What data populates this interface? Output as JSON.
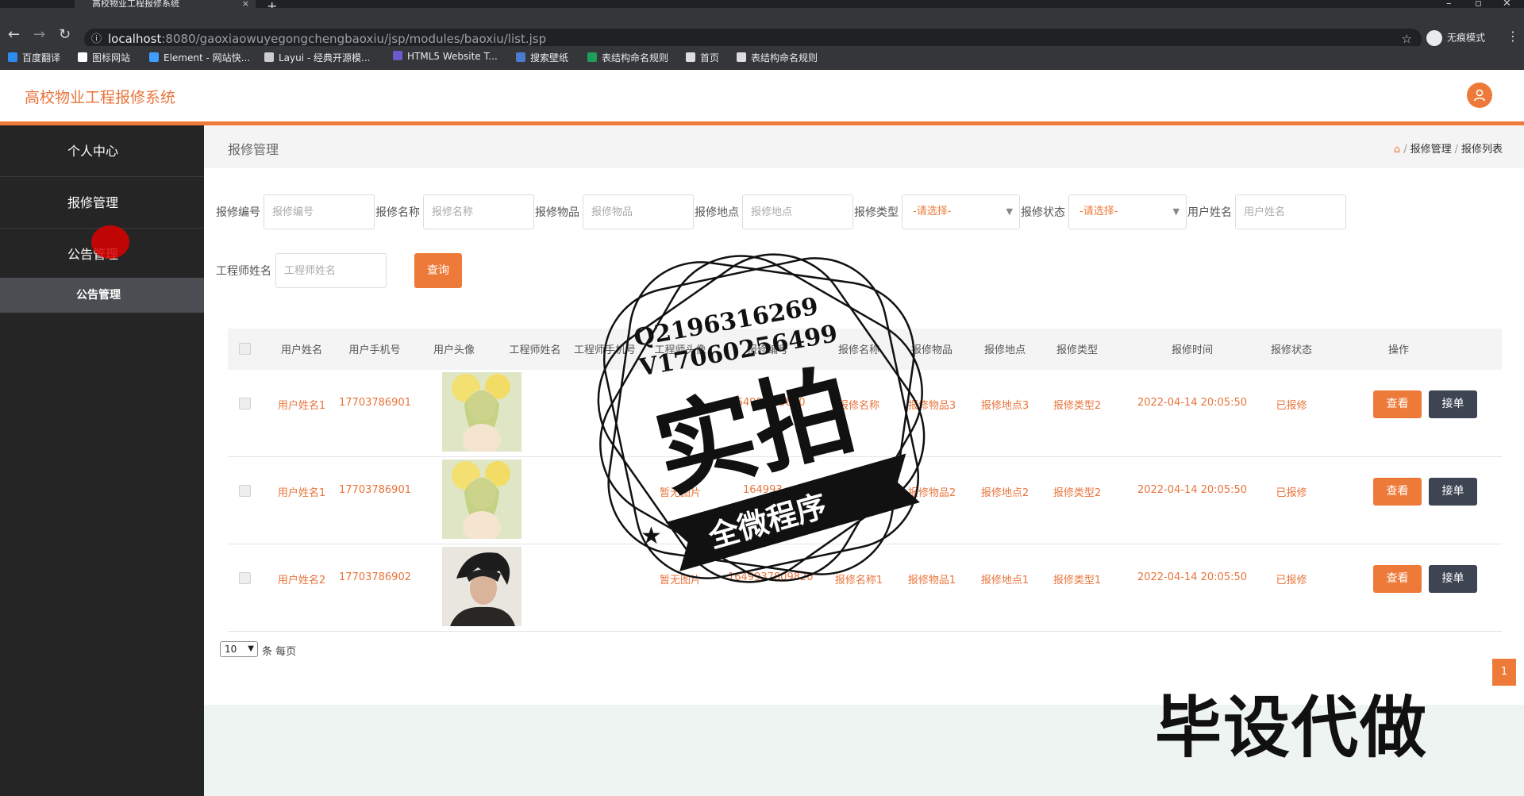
{
  "browser": {
    "tab_title": "高校物业工程报修系统",
    "tab_close": "×",
    "new_tab": "+",
    "url_host": "localhost",
    "url_path": ":8080/gaoxiaowuyegongchengbaoxiu/jsp/modules/baoxiu/list.jsp",
    "incognito_label": "无痕模式",
    "bookmarks": [
      {
        "label": "百度翻译",
        "color": "#2d8cf0"
      },
      {
        "label": "图标网站",
        "color": "#ffffff"
      },
      {
        "label": "Element - 网站快...",
        "color": "#409eff"
      },
      {
        "label": "Layui - 经典开源模...",
        "color": "#cccccc"
      },
      {
        "label": "HTML5 Website T...",
        "color": "#6a5acd"
      },
      {
        "label": "搜索壁纸",
        "color": "#4a7bd0"
      },
      {
        "label": "表结构命名规则",
        "color": "#1e9e5a"
      },
      {
        "label": "首页",
        "color": "#dddddd"
      },
      {
        "label": "表结构命名规则",
        "color": "#dddddd"
      }
    ]
  },
  "app": {
    "title": "高校物业工程报修系统",
    "accent": "#ee7a3a"
  },
  "sidebar": {
    "items": [
      {
        "label": "个人中心"
      },
      {
        "label": "报修管理"
      },
      {
        "label": "公告管理"
      }
    ],
    "sub_item": "公告管理"
  },
  "breadcrumb": {
    "page_title": "报修管理",
    "path": [
      "报修管理",
      "报修列表"
    ]
  },
  "filters": {
    "fields": [
      {
        "label": "报修编号",
        "placeholder": "报修编号"
      },
      {
        "label": "报修名称",
        "placeholder": "报修名称"
      },
      {
        "label": "报修物品",
        "placeholder": "报修物品"
      },
      {
        "label": "报修地点",
        "placeholder": "报修地点"
      }
    ],
    "type_label": "报修类型",
    "type_value": "-请选择-",
    "status_label": "报修状态",
    "status_value": "-请选择-",
    "user_label": "用户姓名",
    "user_placeholder": "用户姓名",
    "engineer_label": "工程师姓名",
    "engineer_placeholder": "工程师姓名",
    "query_button": "查询"
  },
  "table": {
    "columns": [
      "用户姓名",
      "用户手机号",
      "用户头像",
      "工程师姓名",
      "工程师手机号",
      "工程师头像",
      "报修编号",
      "报修名称",
      "报修物品",
      "报修地点",
      "报修类型",
      "报修时间",
      "报修状态",
      "操作"
    ],
    "rows": [
      {
        "user": "用户姓名1",
        "phone": "17703786901",
        "avatar": "girl",
        "img_note": "",
        "code": "16499...09820",
        "name": "报修名称",
        "item": "报修物品3",
        "place": "报修地点3",
        "type": "报修类型2",
        "time": "2022-04-14 20:05:50",
        "status": "已报修"
      },
      {
        "user": "用户姓名1",
        "phone": "17703786901",
        "avatar": "girl",
        "img_note": "暂无图片",
        "code": "164993...",
        "name": "报修名称",
        "item": "报修物品2",
        "place": "报修地点2",
        "type": "报修类型2",
        "time": "2022-04-14 20:05:50",
        "status": "已报修"
      },
      {
        "user": "用户姓名2",
        "phone": "17703786902",
        "avatar": "boy",
        "img_note": "暂无图片",
        "code": "1649937809820",
        "name": "报修名称1",
        "item": "报修物品1",
        "place": "报修地点1",
        "type": "报修类型1",
        "time": "2022-04-14 20:05:50",
        "status": "已报修"
      }
    ],
    "view_button": "查看",
    "take_button": "接单"
  },
  "pagination": {
    "page_size": "10",
    "page_size_suffix": "条 每页",
    "current_page": "1"
  },
  "watermark": {
    "qq": "Q2196316269",
    "vx": "V17060256499",
    "stamp_main": "实拍",
    "stamp_sub": "全微程序",
    "corner": "毕设代做"
  }
}
